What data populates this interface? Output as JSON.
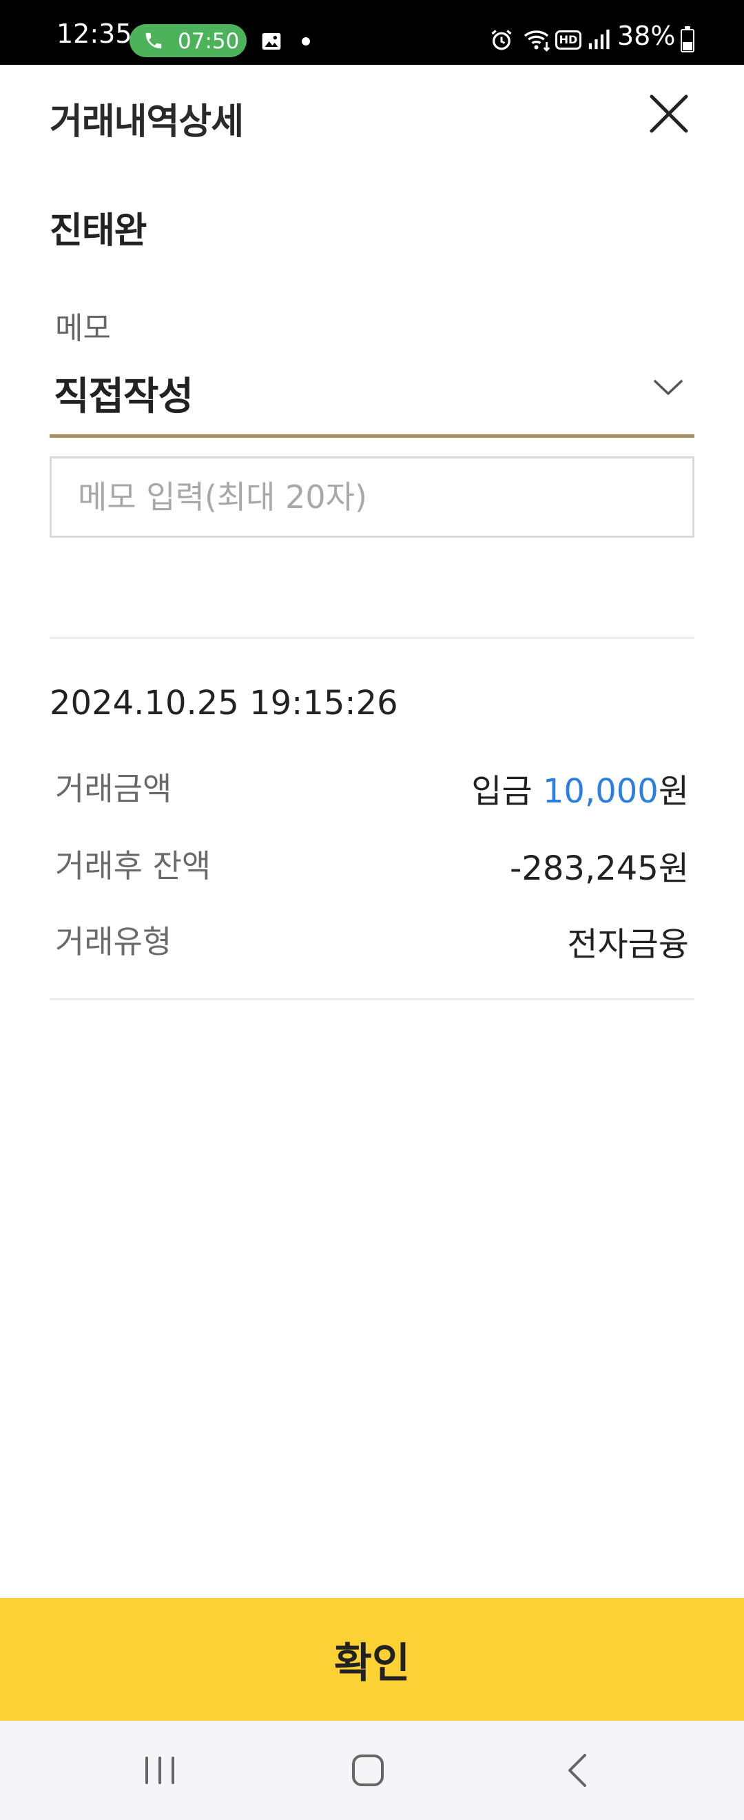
{
  "status_bar": {
    "time": "12:35",
    "call_duration": "07:50",
    "battery_percent": "38%",
    "hd_label": "HD",
    "icons": [
      "phone-icon",
      "gallery-icon",
      "alarm-icon",
      "wifi-icon",
      "signal-icon",
      "battery-icon"
    ]
  },
  "header": {
    "title": "거래내역상세",
    "close_icon": "close-icon"
  },
  "account": {
    "name": "진태완"
  },
  "memo": {
    "label": "메모",
    "selected_option": "직접작성",
    "input_value": "",
    "input_placeholder": "메모 입력(최대 20자)"
  },
  "transaction": {
    "datetime": "2024.10.25 19:15:26",
    "rows": [
      {
        "label": "거래금액",
        "type_word": "입금",
        "amount": "10,000",
        "unit": "원"
      },
      {
        "label": "거래후 잔액",
        "amount": "-283,245",
        "unit": "원"
      },
      {
        "label": "거래유형",
        "value": "전자금융"
      }
    ]
  },
  "colors": {
    "accent_yellow": "#fcd133",
    "underline_gold": "#a89064",
    "amount_blue": "#2b7fe0"
  },
  "confirm_button": {
    "label": "확인"
  },
  "nav_bar": {
    "icons": [
      "recent-apps-icon",
      "home-icon",
      "back-icon"
    ]
  }
}
